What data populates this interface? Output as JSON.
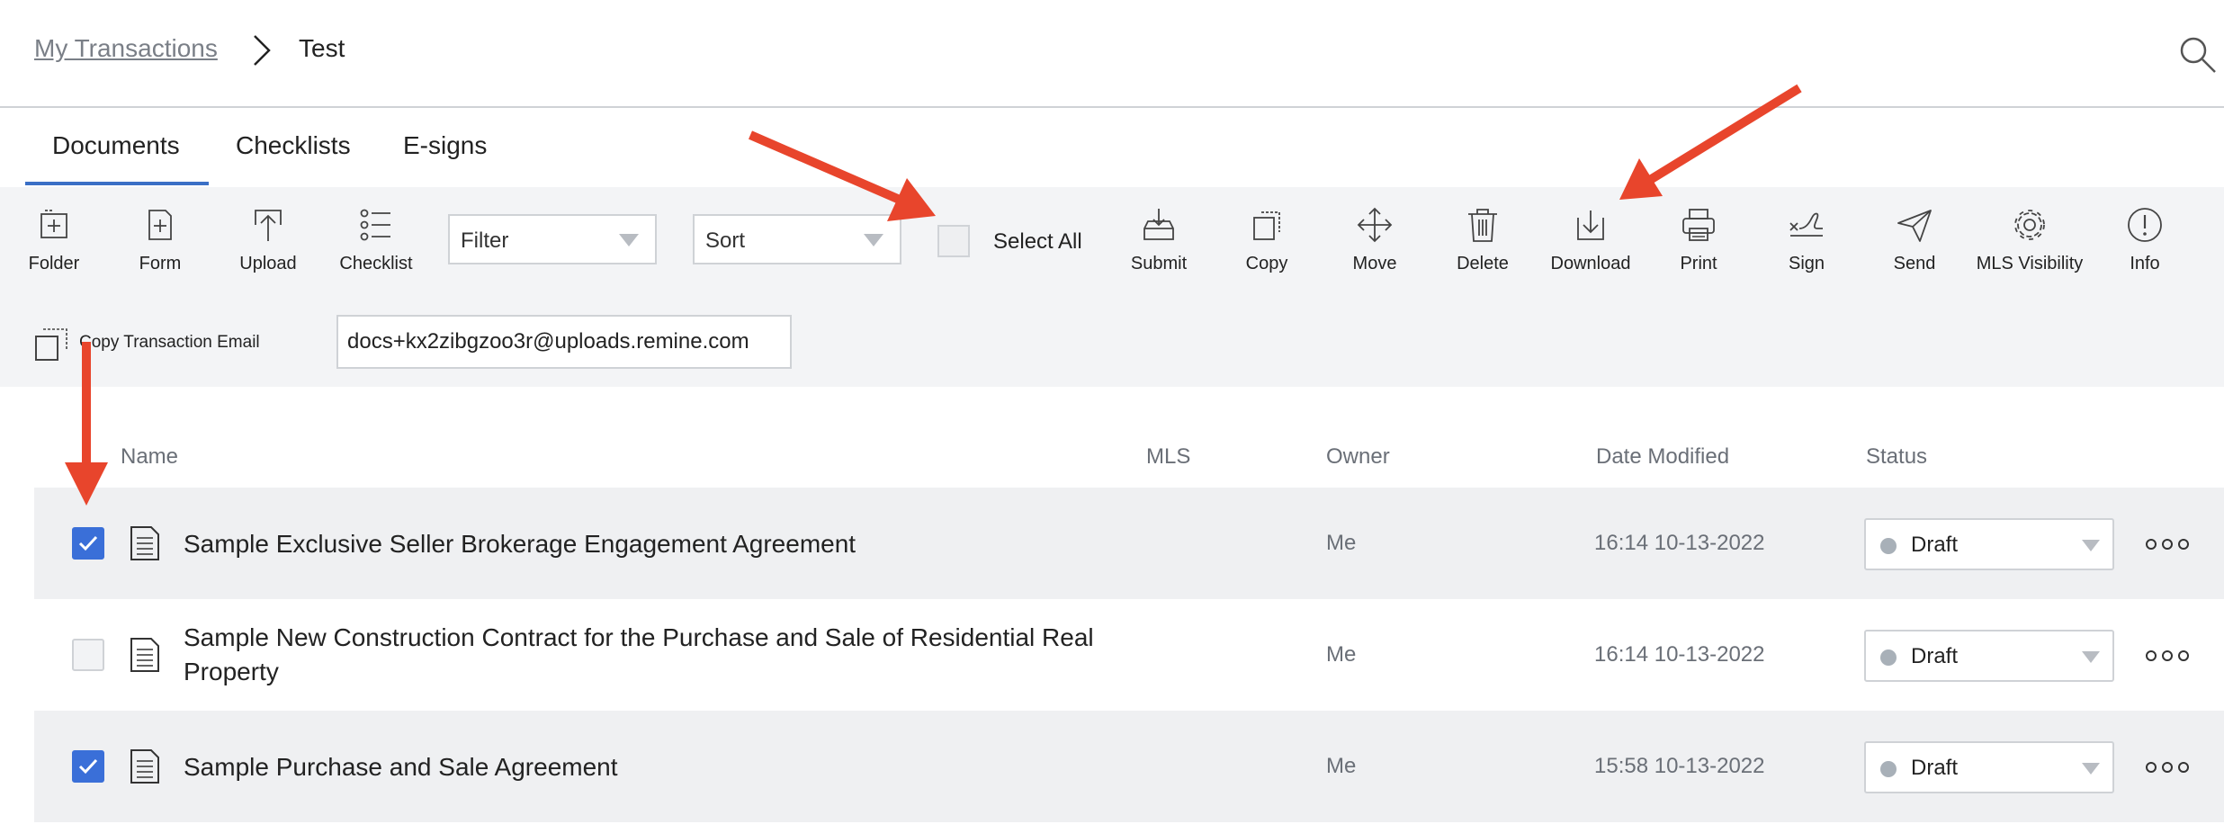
{
  "breadcrumb": {
    "parent": "My Transactions",
    "current": "Test"
  },
  "tabs": [
    {
      "label": "Documents",
      "active": true
    },
    {
      "label": "Checklists",
      "active": false
    },
    {
      "label": "E-signs",
      "active": false
    }
  ],
  "toolbar": {
    "left_tools": [
      {
        "label": "Folder",
        "icon": "folder-add-icon"
      },
      {
        "label": "Form",
        "icon": "form-add-icon"
      },
      {
        "label": "Upload",
        "icon": "upload-icon"
      },
      {
        "label": "Checklist",
        "icon": "checklist-icon"
      }
    ],
    "filter_label": "Filter",
    "sort_label": "Sort",
    "select_all_label": "Select All",
    "right_tools": [
      {
        "label": "Submit",
        "icon": "submit-icon"
      },
      {
        "label": "Copy",
        "icon": "copy-icon"
      },
      {
        "label": "Move",
        "icon": "move-icon"
      },
      {
        "label": "Delete",
        "icon": "trash-icon"
      },
      {
        "label": "Download",
        "icon": "download-icon"
      },
      {
        "label": "Print",
        "icon": "printer-icon"
      },
      {
        "label": "Sign",
        "icon": "signature-icon"
      },
      {
        "label": "Send",
        "icon": "paper-plane-icon"
      },
      {
        "label": "MLS Visibility",
        "icon": "gear-icon"
      },
      {
        "label": "Info",
        "icon": "info-icon"
      }
    ],
    "copy_email_label": "Copy Transaction Email",
    "email_value": "docs+kx2zibgzoo3r@uploads.remine.com"
  },
  "table": {
    "columns": {
      "name": "Name",
      "mls": "MLS",
      "owner": "Owner",
      "date_modified": "Date Modified",
      "status": "Status"
    },
    "rows": [
      {
        "name": "Sample Exclusive Seller Brokerage Engagement Agreement",
        "owner": "Me",
        "date": "16:14 10-13-2022",
        "status": "Draft",
        "checked": true
      },
      {
        "name": "Sample New Construction Contract for the Purchase and Sale of Residential Real Property",
        "owner": "Me",
        "date": "16:14 10-13-2022",
        "status": "Draft",
        "checked": false
      },
      {
        "name": "Sample Purchase and Sale Agreement",
        "owner": "Me",
        "date": "15:58 10-13-2022",
        "status": "Draft",
        "checked": true
      }
    ]
  },
  "colors": {
    "accent": "#3a6fd8",
    "annotation_arrow": "#e8452c",
    "toolbar_bg": "#f3f4f6",
    "row_shaded": "#eff0f2"
  }
}
